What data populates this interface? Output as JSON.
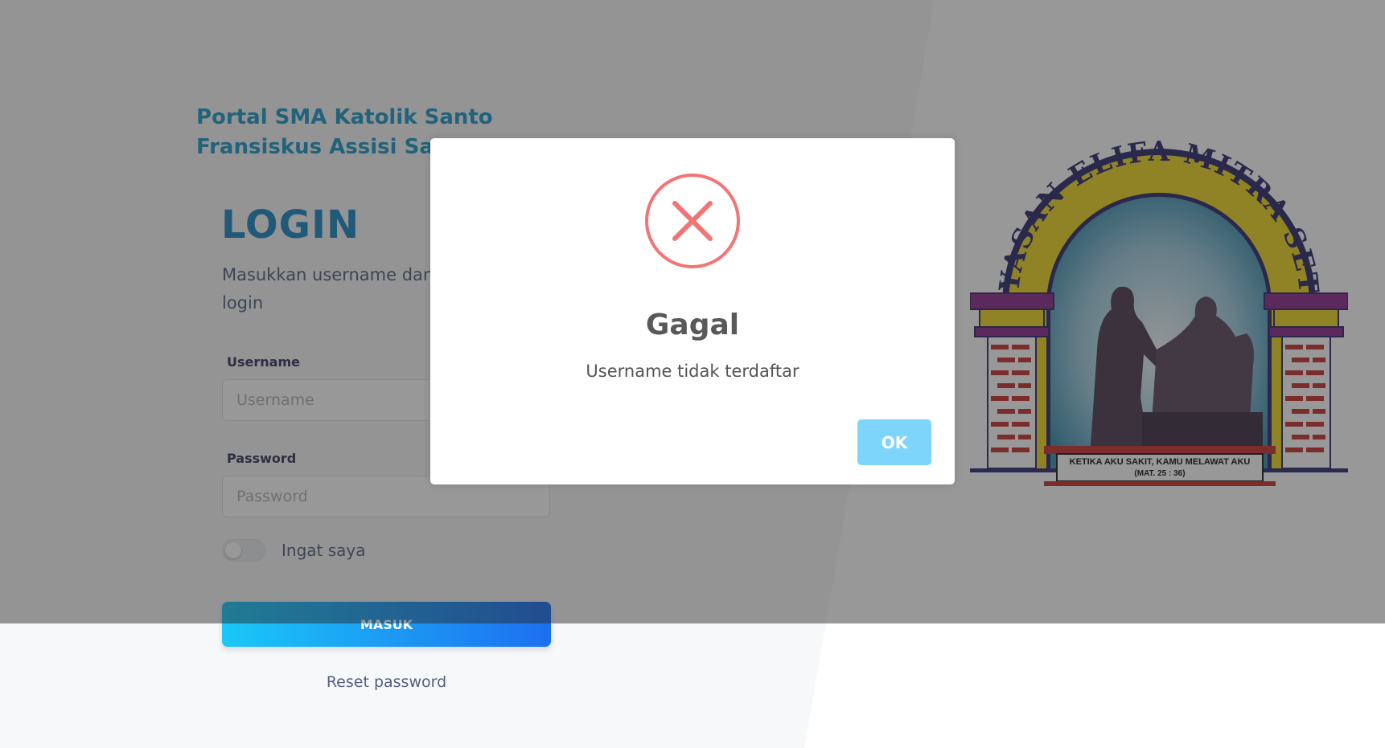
{
  "brand": {
    "portal_title": "Portal SMA Katolik Santo Fransiskus Assisi Sam"
  },
  "login": {
    "heading": "LOGIN",
    "description": "Masukkan username dan Anda untuk login",
    "username_label": "Username",
    "username_placeholder": "Username",
    "username_value": "",
    "password_label": "Password",
    "password_placeholder": "Password",
    "password_value": "",
    "remember_label": "Ingat saya",
    "remember_checked": false,
    "submit_label": "MASUK",
    "reset_label": "Reset password"
  },
  "emblem": {
    "arch_text": "YAYASAN ELIFA MITRA SETIA",
    "plaque_line1": "KETIKA AKU SAKIT, KAMU MELAWAT AKU",
    "plaque_line2": "(MAT. 25 : 36)"
  },
  "dialog": {
    "icon": "error-x-icon",
    "title": "Gagal",
    "message": "Username tidak terdaftar",
    "confirm_label": "OK"
  },
  "colors": {
    "accent": "#1c9ac6",
    "button_gradient_start": "#1ac8f8",
    "button_gradient_end": "#1d6ff0",
    "error": "#f27474",
    "ok_button": "#7dd5fb"
  }
}
